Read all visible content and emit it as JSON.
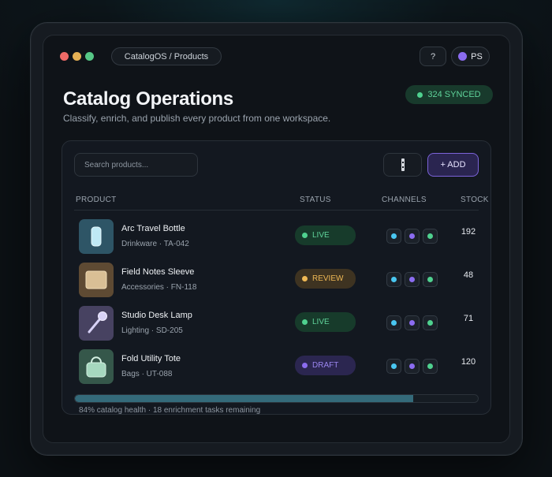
{
  "window": {
    "breadcrumb": "CatalogOS / Products",
    "help_label": "?",
    "user_initials": "PS"
  },
  "header": {
    "title": "Catalog Operations",
    "subtitle": "Classify, enrich, and publish every product from one workspace.",
    "sync_badge": "324 SYNCED"
  },
  "toolbar": {
    "search_placeholder": "Search products...",
    "filter_icon": "filter-icon",
    "add_label": "+ ADD"
  },
  "table": {
    "columns": {
      "product": "PRODUCT",
      "status": "STATUS",
      "channels": "CHANNELS",
      "stock": "STOCK"
    },
    "rows": [
      {
        "name": "Arc Travel Bottle",
        "meta": "Drinkware · TA-042",
        "status": "LIVE",
        "status_kind": "live",
        "stock": "192",
        "thumb_icon": "bottle-icon",
        "thumb_color": "#2e5566"
      },
      {
        "name": "Field Notes Sleeve",
        "meta": "Accessories · FN-118",
        "status": "REVIEW",
        "status_kind": "review",
        "stock": "48",
        "thumb_icon": "notebook-icon",
        "thumb_color": "#5e4a33"
      },
      {
        "name": "Studio Desk Lamp",
        "meta": "Lighting · SD-205",
        "status": "LIVE",
        "status_kind": "live",
        "stock": "71",
        "thumb_icon": "lamp-icon",
        "thumb_color": "#474261"
      },
      {
        "name": "Fold Utility Tote",
        "meta": "Bags · UT-088",
        "status": "DRAFT",
        "status_kind": "draft",
        "stock": "120",
        "thumb_icon": "tote-bag-icon",
        "thumb_color": "#35574a"
      }
    ]
  },
  "health": {
    "percent": 84,
    "caption": "84% catalog health  ·  18 enrichment tasks remaining"
  },
  "colors": {
    "accent_purple": "#8b6cf0",
    "live_green": "#4fd18f",
    "review_amber": "#f0b955",
    "channel_blue": "#49c6f0"
  }
}
